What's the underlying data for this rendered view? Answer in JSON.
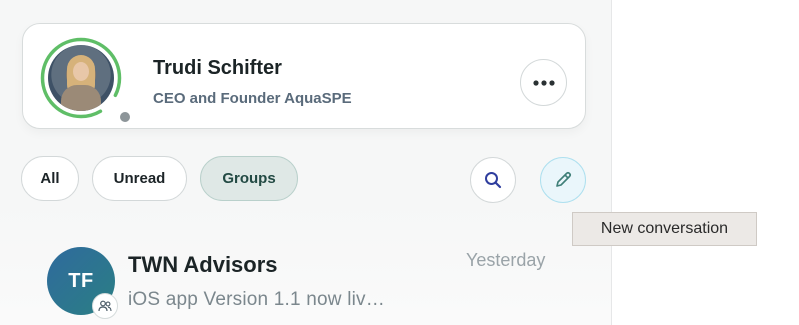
{
  "profile": {
    "name": "Trudi Schifter",
    "title": "CEO and Founder AquaSPE",
    "more_icon": "more-horizontal-icon",
    "ring_color": "#5fbe67"
  },
  "filters": {
    "all": "All",
    "unread": "Unread",
    "groups": "Groups",
    "active": "Groups"
  },
  "actions": {
    "search_icon": "search-icon",
    "compose_icon": "pencil-icon",
    "compose_tooltip": "New conversation"
  },
  "conversations": [
    {
      "initials": "TF",
      "name": "TWN Advisors",
      "time": "Yesterday",
      "preview": "iOS app Version 1.1 now liv…",
      "badge_icon": "group-icon"
    }
  ]
}
